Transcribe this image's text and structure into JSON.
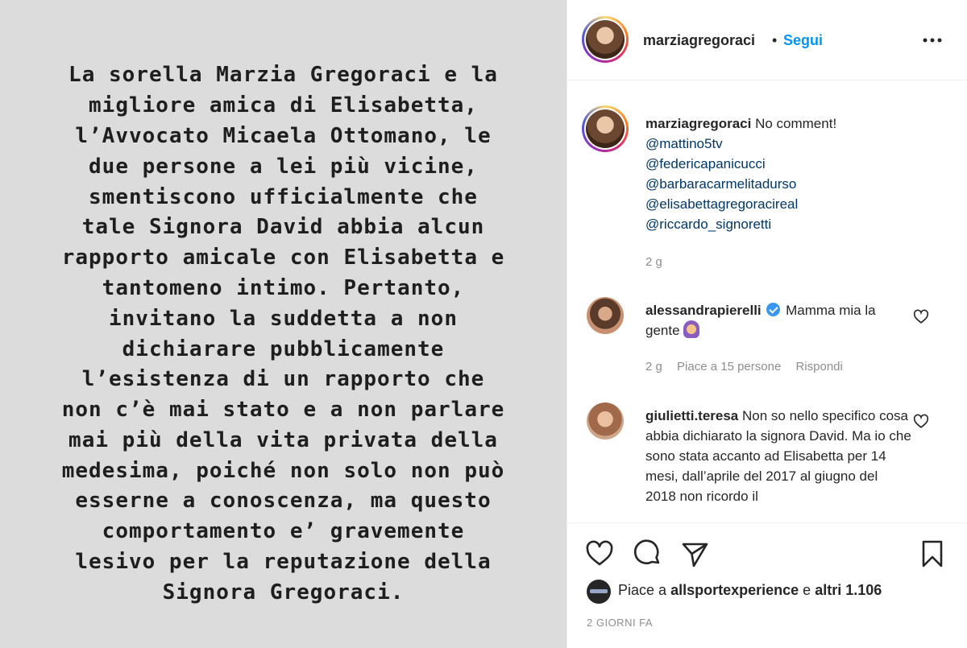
{
  "story": {
    "lines": [
      "La sorella Marzia Gregoraci e la",
      "migliore amica di Elisabetta,",
      "l’Avvocato Micaela Ottomano, le",
      "due persone a lei più vicine,",
      "smentiscono ufficialmente che",
      "tale Signora David abbia alcun",
      "rapporto amicale con Elisabetta e",
      "tantomeno intimo. Pertanto,",
      "invitano la suddetta a non",
      "dichiarare pubblicamente",
      "l’esistenza di un rapporto che",
      "non c’è mai stato e a non parlare",
      "mai più della vita privata della",
      "medesima, poiché non solo non può",
      "esserne a conoscenza, ma questo",
      "comportamento e’ gravemente",
      "lesivo per la reputazione della",
      "Signora Gregoraci."
    ]
  },
  "header": {
    "username": "marziagregoraci",
    "dot": "•",
    "follow_label": "Segui",
    "more_icon": "more-horizontal-icon"
  },
  "caption": {
    "username": "marziagregoraci",
    "text": "No comment!",
    "mentions": [
      "@mattino5tv",
      "@federicapanicucci",
      "@barbaracarmelitadurso",
      "@elisabettagregoracireal",
      "@riccardo_signoretti"
    ],
    "time": "2 g"
  },
  "comments": [
    {
      "username": "alessandrapierelli",
      "verified": true,
      "text": "Mamma mia la gente",
      "time": "2 g",
      "likes": "Piace a 15 persone",
      "reply": "Rispondi"
    },
    {
      "username": "giulietti.teresa",
      "text": "Non so nello specifico cosa abbia dichiarato la signora David. Ma io che sono stata accanto ad Elisabetta per 14 mesi, dall’aprile del 2017 al giugno del 2018 non ricordo il"
    }
  ],
  "actions": {
    "likes_prefix": "Piace a",
    "likes_user": "allsportexperience",
    "likes_middle": "e",
    "likes_others": "altri 1.106",
    "date": "2 GIORNI FA"
  },
  "colors": {
    "link": "#0095f6",
    "mention": "#00376b",
    "muted": "#8e8e8e",
    "story_bg": "#dcdcdc"
  }
}
